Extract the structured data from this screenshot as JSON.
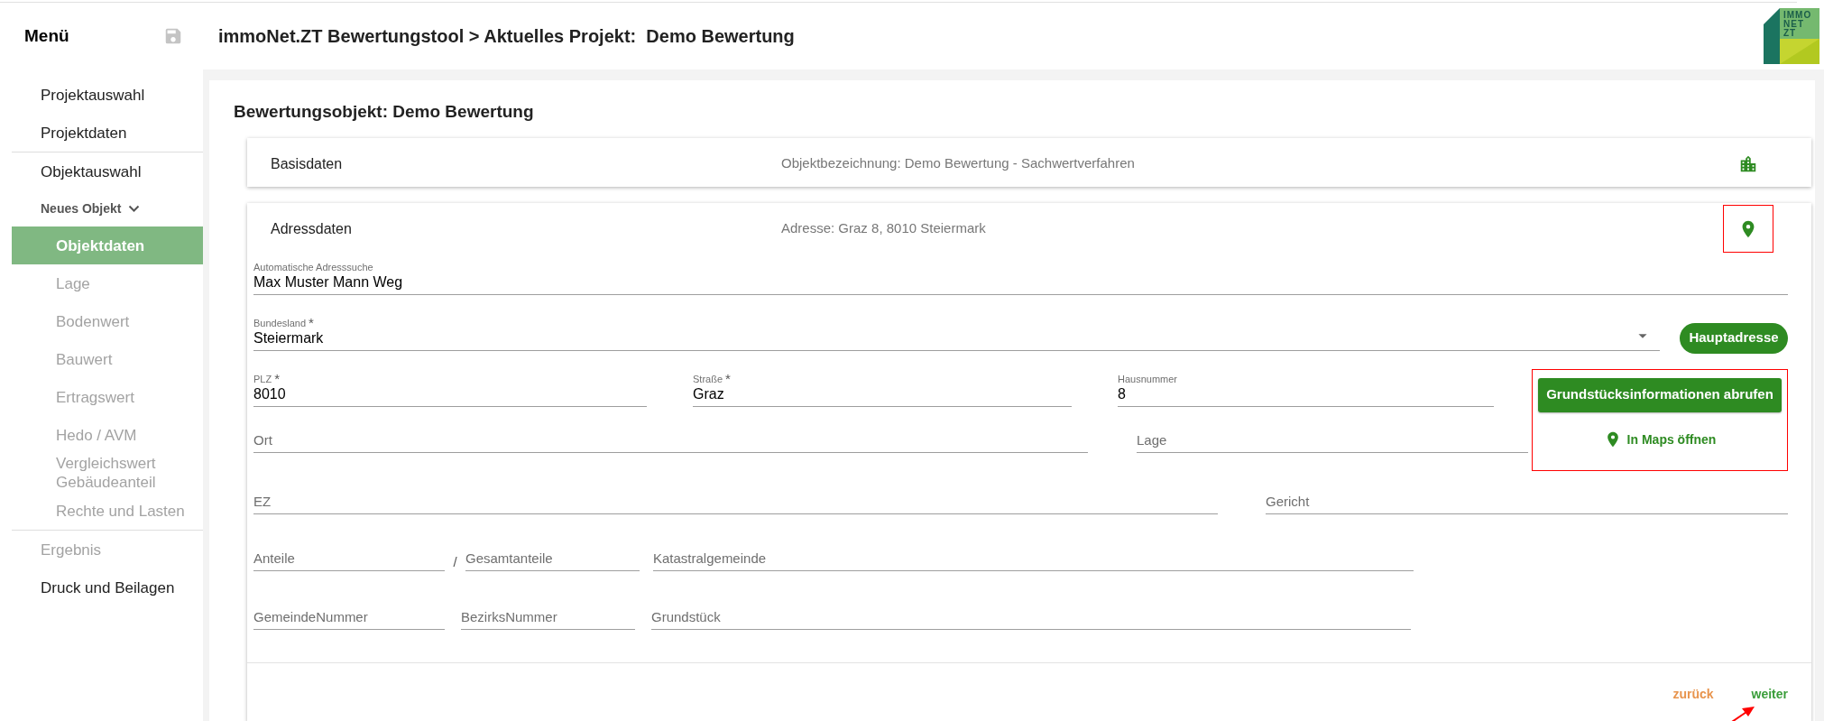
{
  "sidebar": {
    "title": "Menü",
    "sections": [
      [
        {
          "label": "Projektauswahl",
          "disabled": false,
          "selected": false
        },
        {
          "label": "Projektdaten",
          "disabled": false,
          "selected": false
        }
      ],
      [
        {
          "label": "Objektauswahl",
          "disabled": false,
          "selected": false
        },
        {
          "label": "Neues Objekt",
          "expanded": true,
          "children": [
            {
              "label": "Objektdaten",
              "disabled": false,
              "selected": true
            },
            {
              "label": "Lage",
              "disabled": true,
              "selected": false
            },
            {
              "label": "Bodenwert",
              "disabled": true,
              "selected": false
            },
            {
              "label": "Bauwert",
              "disabled": true,
              "selected": false
            },
            {
              "label": "Ertragswert",
              "disabled": true,
              "selected": false
            },
            {
              "label": "Hedo / AVM",
              "disabled": true,
              "selected": false
            },
            {
              "label": "Vergleichswert Gebäudeanteil",
              "disabled": true,
              "selected": false
            },
            {
              "label": "Rechte und Lasten",
              "disabled": true,
              "selected": false
            }
          ]
        }
      ],
      [
        {
          "label": "Ergebnis",
          "disabled": true,
          "selected": false
        },
        {
          "label": "Druck und Beilagen",
          "disabled": false,
          "selected": false
        }
      ]
    ]
  },
  "header": {
    "title": "immoNet.ZT Bewertungstool > Aktuelles Projekt:  Demo Bewertung",
    "logo_lines": [
      "IMMO",
      "NET",
      "ZT"
    ]
  },
  "page_title": "Bewertungsobjekt: Demo Bewertung",
  "panels": [
    {
      "title": "Basisdaten",
      "summary": "Objektbezeichnung: Demo Bewertung - Sachwertverfahren",
      "kind": "building",
      "annotated": false
    },
    {
      "title": "Adressdaten",
      "summary": "Adresse: Graz 8, 8010 Steiermark",
      "kind": "pin",
      "annotated": true
    }
  ],
  "form": {
    "search": {
      "label": "Automatische Adresssuche",
      "value": "Max Muster Mann Weg"
    },
    "state": {
      "label": "Bundesland",
      "required_mark": "*",
      "value": "Steiermark"
    },
    "main_address_button": "Hauptadresse",
    "address": [
      {
        "label": "PLZ",
        "required_mark": "*",
        "value": "8010"
      },
      {
        "label": "Straße",
        "required_mark": "*",
        "value": "Graz"
      },
      {
        "label": "Hausnummer",
        "value": "8"
      }
    ],
    "place": [
      {
        "placeholder": "Ort"
      },
      {
        "placeholder": "Lage"
      }
    ],
    "actions": {
      "primary": "Grundstücksinformationen abrufen",
      "maps": "In Maps öffnen",
      "annotated": true
    },
    "court": [
      {
        "placeholder": "EZ"
      },
      {
        "placeholder": "Gericht"
      }
    ],
    "shares": {
      "fields": [
        {
          "placeholder": "Anteile"
        },
        {
          "placeholder": "Gesamtanteile"
        },
        {
          "placeholder": "Katastralgemeinde"
        }
      ],
      "separator": "/"
    },
    "numbers": [
      {
        "placeholder": "GemeindeNummer"
      },
      {
        "placeholder": "BezirksNummer"
      },
      {
        "placeholder": "Grundstück"
      }
    ]
  },
  "footer": {
    "back": "zurück",
    "next": "weiter",
    "arrow_annotation": true
  }
}
